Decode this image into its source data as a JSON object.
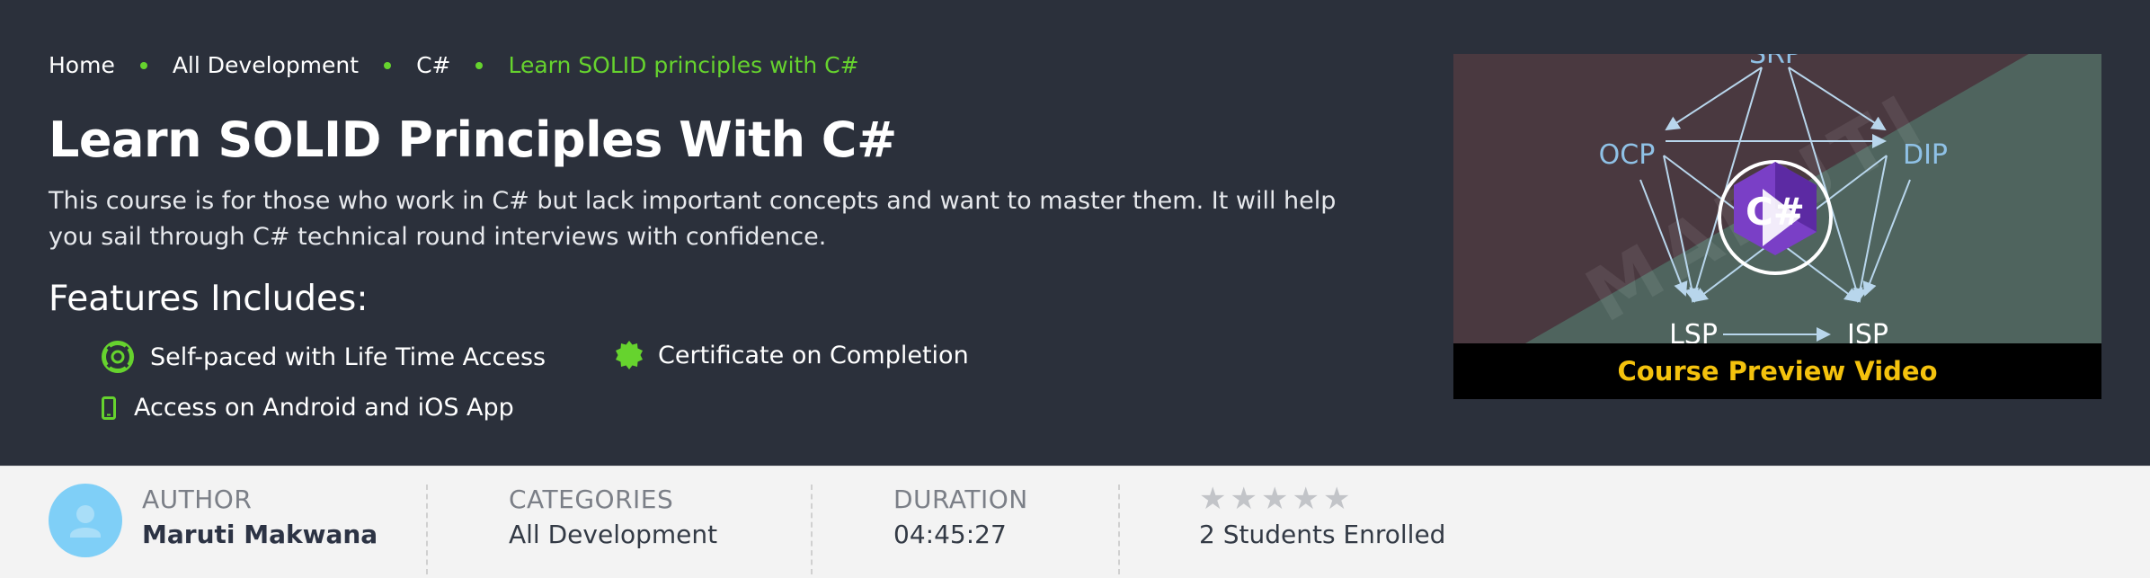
{
  "breadcrumb": [
    {
      "label": "Home",
      "active": false
    },
    {
      "label": "All Development",
      "active": false
    },
    {
      "label": "C#",
      "active": false
    },
    {
      "label": "Learn SOLID principles with C#",
      "active": true
    }
  ],
  "course": {
    "title": "Learn SOLID Principles With C#",
    "description": "This course is for those who work in C# but lack important concepts and want to master them. It will help you sail through C# technical round interviews with confidence."
  },
  "features": {
    "heading": "Features Includes:",
    "items": [
      {
        "label": "Self-paced with Life Time Access",
        "icon": "lifebuoy-icon"
      },
      {
        "label": "Certificate on Completion",
        "icon": "certificate-badge-icon"
      },
      {
        "label": "Access on Android and iOS App",
        "icon": "mobile-phone-icon"
      }
    ]
  },
  "preview": {
    "caption": "Course Preview Video",
    "labels": [
      "SRP",
      "OCP",
      "DIP",
      "LSP",
      "ISP"
    ],
    "watermark": "MARUTI",
    "logo_text": "C#"
  },
  "info": {
    "author_label": "AUTHOR",
    "author_name": "Maruti Makwana",
    "categories_label": "CATEGORIES",
    "categories_value": "All Development",
    "duration_label": "DURATION",
    "duration_value": "04:45:27",
    "rating": 0,
    "rating_max": 5,
    "enrolled": "2 Students Enrolled"
  },
  "colors": {
    "hero_bg": "#2b303b",
    "accent_green": "#66d32e",
    "caption_yellow": "#f4c20d",
    "info_bg": "#f3f3f3",
    "avatar_bg": "#7fcff7"
  }
}
